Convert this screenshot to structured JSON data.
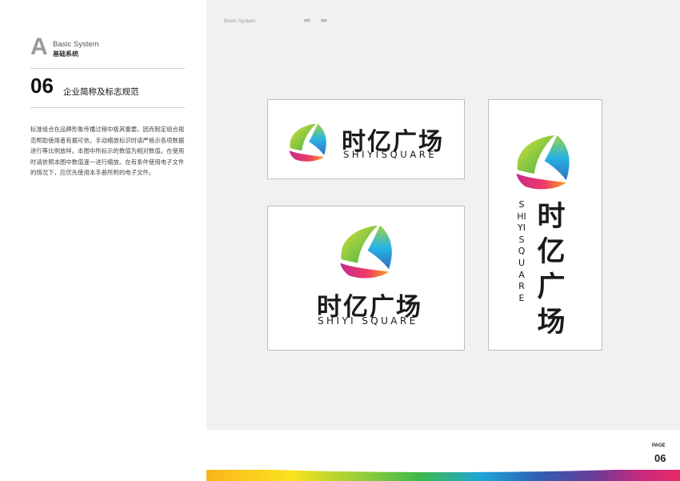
{
  "section": {
    "letter": "A",
    "name_en": "Basic System",
    "name_cn": "基础系统"
  },
  "topic": {
    "number": "06",
    "title": "企业简称及标志规范"
  },
  "description": "标准组合在品牌形象传播过程中极其重要。因而制定组合规范帮助使用者有据可依。手动缩放标识时请严格示各项数据进行等比例放样。本图中所标示的数值为相对数值。在使用时请依照本图中数值逐一进行缩放。在有条件使用电子文件的情况下，应优先使用本手册所附的电子文件。",
  "header": {
    "breadcrumb": "Basic System",
    "prev": "<<",
    "next": ">>"
  },
  "brand": {
    "name_cn": "时亿广场",
    "name_en": "SHIYISQUARE",
    "name_en_spaced": "SHIYI SQUARE",
    "colors": [
      "#8cc63f",
      "#2cb5e8",
      "#e8296b",
      "#f7a21b",
      "#7b3fa0"
    ]
  },
  "footer": {
    "page_label": "PAGE",
    "page_number": "06"
  }
}
